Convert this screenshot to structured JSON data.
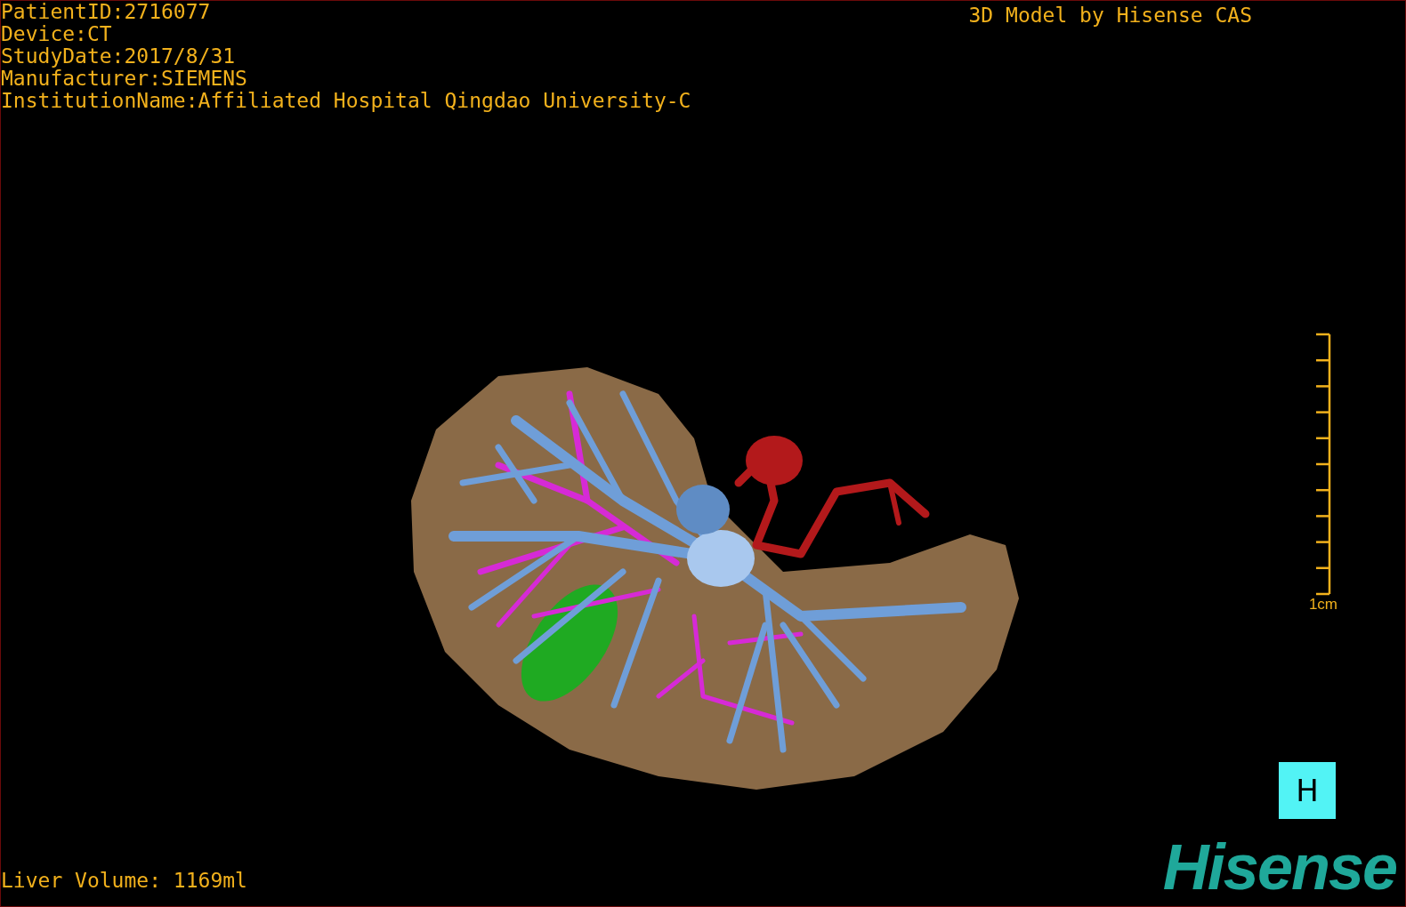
{
  "info_lines": [
    "PatientID:2716077",
    "Device:CT",
    "StudyDate:2017/8/31",
    "Manufacturer:SIEMENS",
    "InstitutionName:Affiliated Hospital Qingdao University-C"
  ],
  "title": "3D Model by Hisense CAS",
  "scale_bar": {
    "label": "1cm"
  },
  "volume": "Liver Volume: 1169ml",
  "view_button": {
    "label": "H"
  },
  "logo": "Hisense"
}
